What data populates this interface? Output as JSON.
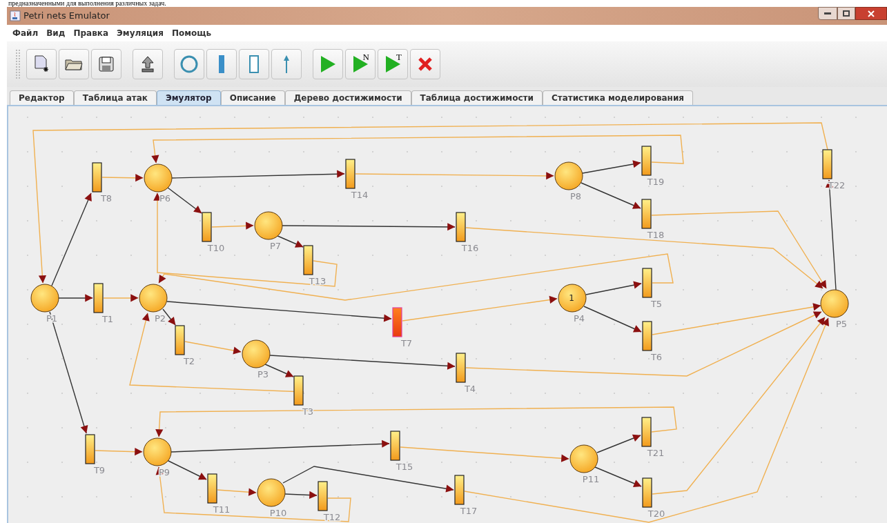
{
  "document_text": "предназначенными для выполнения различных задач.",
  "window": {
    "title": "Petri nets Emulator"
  },
  "menu": [
    "Файл",
    "Вид",
    "Правка",
    "Эмуляция",
    "Помощь"
  ],
  "toolbar": [
    {
      "kind": "new"
    },
    {
      "kind": "open"
    },
    {
      "kind": "save"
    },
    {
      "kind": "export"
    },
    {
      "kind": "place"
    },
    {
      "kind": "transition"
    },
    {
      "kind": "empty-transition"
    },
    {
      "kind": "arc"
    },
    {
      "kind": "run"
    },
    {
      "kind": "run",
      "label": "N"
    },
    {
      "kind": "run",
      "label": "T"
    },
    {
      "kind": "stop"
    }
  ],
  "tabs": [
    {
      "label": "Редактор",
      "selected": false
    },
    {
      "label": "Таблица атак",
      "selected": false
    },
    {
      "label": "Эмулятор",
      "selected": true
    },
    {
      "label": "Описание",
      "selected": false
    },
    {
      "label": "Дерево достижимости",
      "selected": false
    },
    {
      "label": "Таблица достижимости",
      "selected": false
    },
    {
      "label": "Статистика моделирования",
      "selected": false
    }
  ],
  "places": [
    {
      "label": "P6"
    },
    {
      "label": "P8"
    },
    {
      "label": "P7"
    },
    {
      "label": "P1"
    },
    {
      "label": "P2"
    },
    {
      "label": "P4",
      "tokens": "1"
    },
    {
      "label": "P5"
    },
    {
      "label": "P3"
    },
    {
      "label": "P9"
    },
    {
      "label": "P11"
    },
    {
      "label": "P10"
    }
  ],
  "transitions": [
    {
      "label": "T19",
      "enabled": false
    },
    {
      "label": "T22",
      "enabled": false
    },
    {
      "label": "T8",
      "enabled": false
    },
    {
      "label": "T14",
      "enabled": false
    },
    {
      "label": "T18",
      "enabled": false
    },
    {
      "label": "T10",
      "enabled": false
    },
    {
      "label": "T16",
      "enabled": false
    },
    {
      "label": "T13",
      "enabled": false
    },
    {
      "label": "T5",
      "enabled": false
    },
    {
      "label": "T1",
      "enabled": false
    },
    {
      "label": "T7",
      "enabled": true
    },
    {
      "label": "T6",
      "enabled": false
    },
    {
      "label": "T2",
      "enabled": false
    },
    {
      "label": "T4",
      "enabled": false
    },
    {
      "label": "T3",
      "enabled": false
    },
    {
      "label": "T21",
      "enabled": false
    },
    {
      "label": "T15",
      "enabled": false
    },
    {
      "label": "T9",
      "enabled": false
    },
    {
      "label": "T11",
      "enabled": false
    },
    {
      "label": "T17",
      "enabled": false
    },
    {
      "label": "T20",
      "enabled": false
    },
    {
      "label": "T12",
      "enabled": false
    }
  ]
}
